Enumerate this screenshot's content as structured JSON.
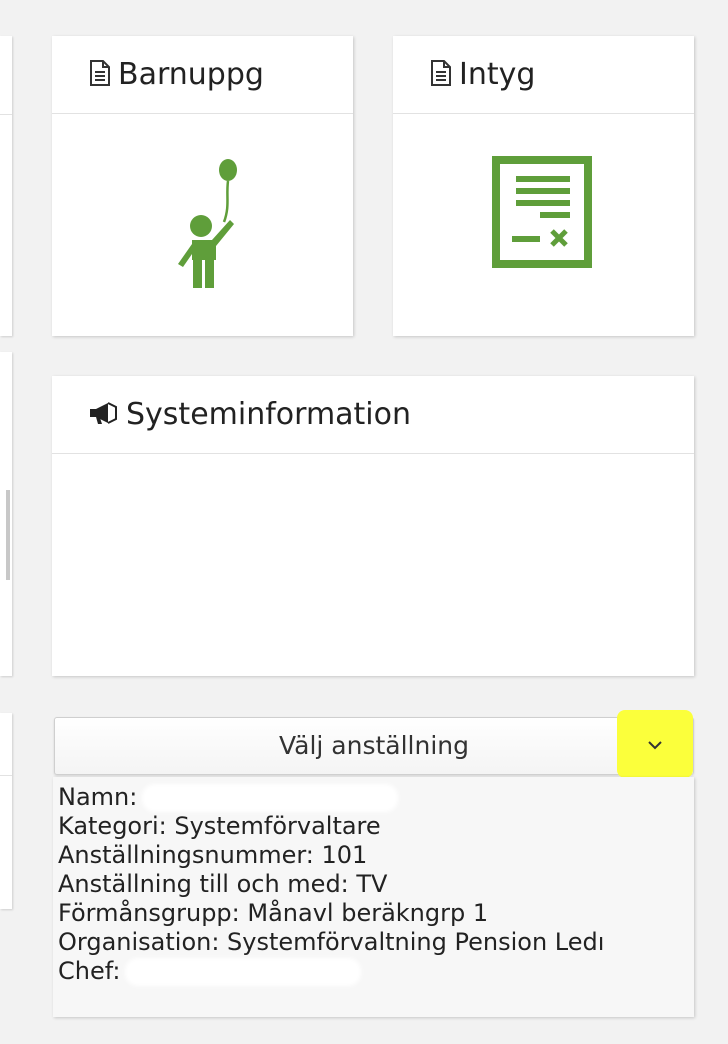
{
  "tiles": {
    "barnuppg": {
      "title": "Barnuppg",
      "icon": "document-icon"
    },
    "intyg": {
      "title": "Intyg",
      "icon": "document-icon"
    }
  },
  "system_info": {
    "title": "Systeminformation",
    "icon": "megaphone-icon"
  },
  "employment_select": {
    "label": "Välj anställning",
    "highlight_color": "#fbff3b"
  },
  "employee": {
    "name_label": "Namn:",
    "category": "Kategori: Systemförvaltare",
    "employee_number": "Anställningsnummer: 101",
    "employment_until": "Anställning till och med: TV",
    "benefit_group": "Förmånsgrupp: Månavl beräkngrp 1",
    "organisation": "Organisation: Systemförvaltning Pension Ledı",
    "manager_label": "Chef:"
  },
  "colors": {
    "accent_green": "#5f9e3a",
    "icon_green_dark": "#4a8a2c"
  }
}
